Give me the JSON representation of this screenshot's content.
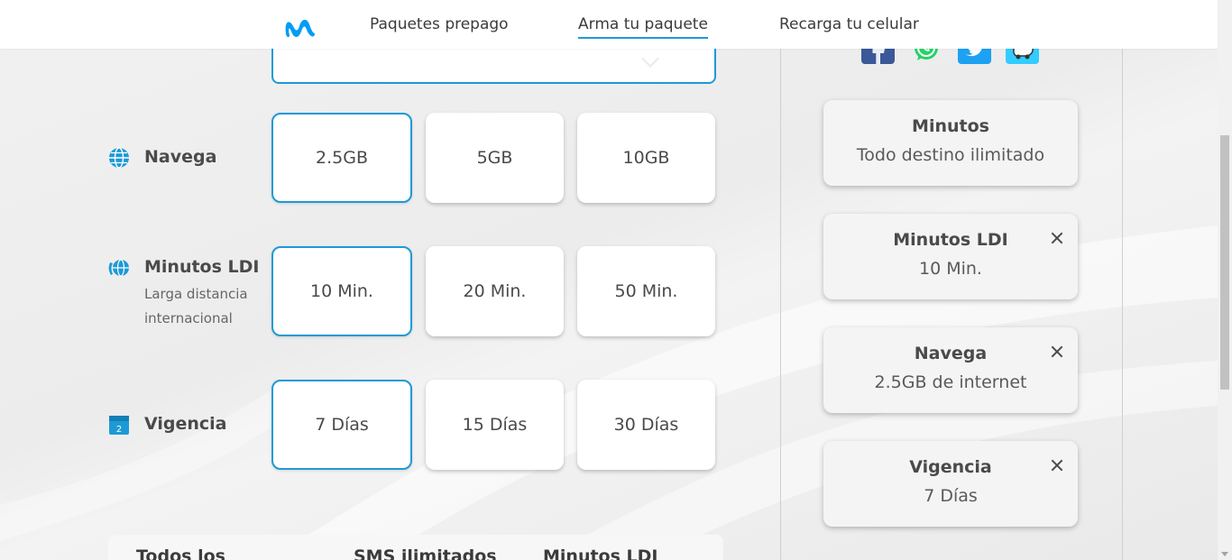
{
  "header": {
    "nav": [
      {
        "label": "Paquetes prepago"
      },
      {
        "label": "Arma tu paquete"
      },
      {
        "label": "Recarga tu celular"
      }
    ]
  },
  "rows": {
    "navega": {
      "title": "Navega",
      "options": [
        "2.5GB",
        "5GB",
        "10GB"
      ],
      "selected": "2.5GB"
    },
    "ldi": {
      "title": "Minutos LDI",
      "subtitle": "Larga distancia internacional",
      "options": [
        "10 Min.",
        "20 Min.",
        "50 Min."
      ],
      "selected": "10 Min."
    },
    "vigencia": {
      "title": "Vigencia",
      "calendar_number": "2",
      "options": [
        "7 Días",
        "15 Días",
        "30 Días"
      ],
      "selected": "7 Días"
    }
  },
  "bottom": {
    "col1": "Todos los",
    "col2": "SMS ilimitados",
    "col3": "Minutos LDI"
  },
  "summary": [
    {
      "title": "Minutos",
      "value": "Todo destino ilimitado",
      "removable": false
    },
    {
      "title": "Minutos LDI",
      "value": "10 Min.",
      "removable": true
    },
    {
      "title": "Navega",
      "value": "2.5GB de internet",
      "removable": true
    },
    {
      "title": "Vigencia",
      "value": "7 Días",
      "removable": true
    }
  ],
  "social": [
    "facebook-icon",
    "whatsapp-icon",
    "twitter-icon",
    "waze-icon"
  ],
  "colors": {
    "accent": "#1d9ad6",
    "logo": "#019df4",
    "facebook": "#3b5998",
    "whatsapp": "#25d366",
    "twitter": "#1da1f2",
    "waze": "#33ccff"
  }
}
